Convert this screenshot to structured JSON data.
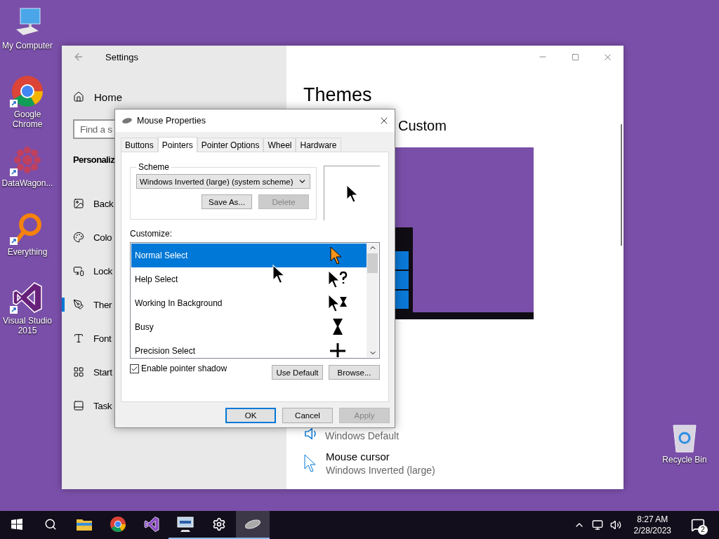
{
  "desktop": {
    "icons": [
      {
        "kind": "computer",
        "label": "My Computer"
      },
      {
        "kind": "chrome",
        "label": "Google Chrome"
      },
      {
        "kind": "datawagon",
        "label": "DataWagon..."
      },
      {
        "kind": "everything",
        "label": "Everything"
      },
      {
        "kind": "visualstudio",
        "label": "Visual Studio 2015"
      }
    ],
    "recycle_bin": {
      "label": "Recycle Bin"
    }
  },
  "settings": {
    "title": "Settings",
    "home": "Home",
    "search": {
      "placeholder": "Find a s"
    },
    "section": "Personaliz",
    "nav": [
      {
        "kind": "background",
        "label": "Back",
        "selected": false
      },
      {
        "kind": "colors",
        "label": "Colo",
        "selected": false
      },
      {
        "kind": "lockscreen",
        "label": "Lock",
        "selected": false
      },
      {
        "kind": "themes",
        "label": "Ther",
        "selected": true
      },
      {
        "kind": "fonts",
        "label": "Font",
        "selected": false
      },
      {
        "kind": "start",
        "label": "Start",
        "selected": false
      },
      {
        "kind": "taskbar",
        "label": "Task",
        "selected": false
      }
    ],
    "heading": "Themes",
    "current_theme": "Custom",
    "options": [
      {
        "kind": "sound",
        "subtitle": "Windows Default"
      },
      {
        "kind": "cursor",
        "title": "Mouse cursor",
        "subtitle": "Windows Inverted (large)"
      }
    ]
  },
  "dialog": {
    "title": "Mouse Properties",
    "tabs": [
      {
        "label": "Buttons",
        "selected": false
      },
      {
        "label": "Pointers",
        "selected": true
      },
      {
        "label": "Pointer Options",
        "selected": false
      },
      {
        "label": "Wheel",
        "selected": false
      },
      {
        "label": "Hardware",
        "selected": false
      }
    ],
    "scheme": {
      "legend": "Scheme",
      "value": "Windows Inverted (large) (system scheme)",
      "buttons": [
        {
          "label": "Save As...",
          "disabled": false
        },
        {
          "label": "Delete",
          "disabled": true
        }
      ]
    },
    "customize_label": "Customize:",
    "cursors": [
      {
        "kind": "normal",
        "name": "Normal Select",
        "selected": true
      },
      {
        "kind": "help",
        "name": "Help Select",
        "selected": false
      },
      {
        "kind": "working",
        "name": "Working In Background",
        "selected": false
      },
      {
        "kind": "busy",
        "name": "Busy",
        "selected": false
      },
      {
        "kind": "precision",
        "name": "Precision Select",
        "selected": false
      }
    ],
    "shadow": {
      "label": "Enable pointer shadow",
      "checked": true
    },
    "list_buttons": [
      "Use Default",
      "Browse..."
    ],
    "footer_buttons": [
      {
        "label": "OK",
        "default": true,
        "disabled": false
      },
      {
        "label": "Cancel",
        "default": false,
        "disabled": false
      },
      {
        "label": "Apply",
        "default": false,
        "disabled": true
      }
    ]
  },
  "taskbar": {
    "apps": [
      {
        "kind": "start",
        "running": false,
        "active": false
      },
      {
        "kind": "search",
        "running": false,
        "active": false
      },
      {
        "kind": "explorer",
        "running": false,
        "active": false
      },
      {
        "kind": "chrome",
        "running": false,
        "active": false
      },
      {
        "kind": "visualstudio",
        "running": false,
        "active": false
      },
      {
        "kind": "network",
        "running": true,
        "active": false
      },
      {
        "kind": "settings",
        "running": true,
        "active": false
      },
      {
        "kind": "mouse",
        "running": true,
        "active": true
      }
    ],
    "clock": {
      "time": "8:27 AM",
      "date": "2/28/2023"
    },
    "notifications": "2"
  }
}
